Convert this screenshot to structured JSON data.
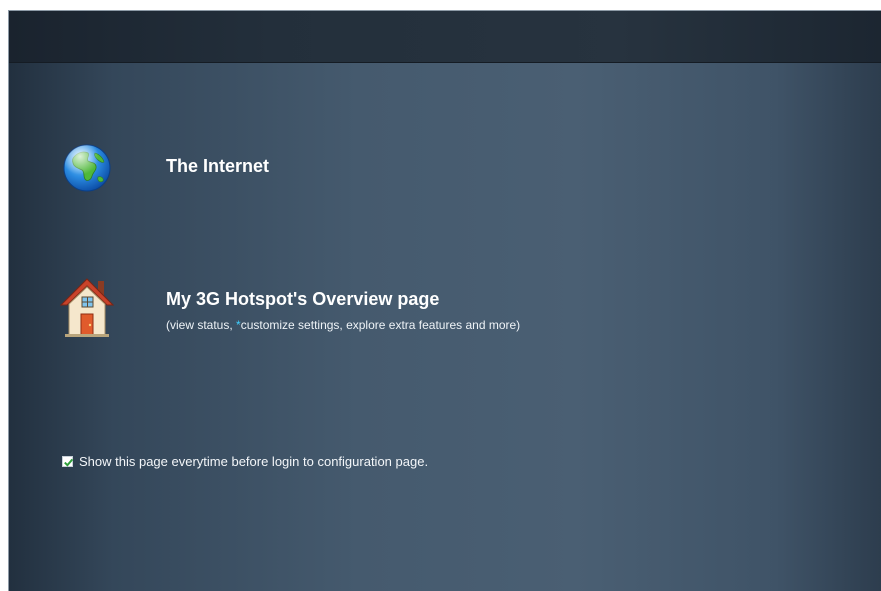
{
  "options": [
    {
      "id": "internet",
      "icon": "globe-icon",
      "title": "The Internet"
    },
    {
      "id": "overview",
      "icon": "house-icon",
      "title": "My 3G Hotspot's Overview page",
      "description_prefix": "(view status, ",
      "description_asterisk": "*",
      "description_suffix": "customize settings, explore extra features and more)"
    }
  ],
  "preference": {
    "checked": true,
    "label": "Show this page everytime before login to configuration page."
  },
  "colors": {
    "accent_asterisk": "#3fd0ff",
    "checkbox_check": "#2e9e3a"
  }
}
